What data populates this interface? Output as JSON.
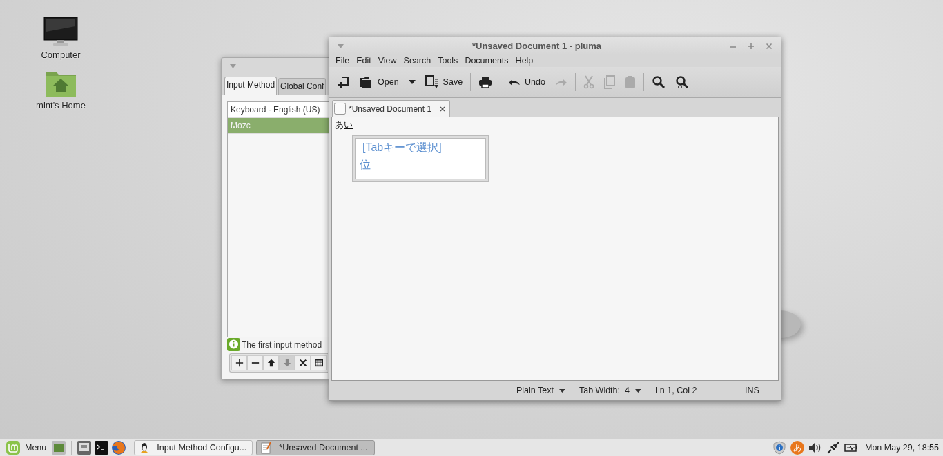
{
  "desktop": {
    "icons": [
      {
        "kind": "computer",
        "label": "Computer"
      },
      {
        "kind": "home",
        "label": "mint's Home"
      }
    ]
  },
  "config_window": {
    "tabs": [
      {
        "label": "Input Method",
        "selected": true
      },
      {
        "label": "Global Conf",
        "selected": false
      }
    ],
    "list": [
      {
        "label": "Keyboard - English (US)",
        "selected": false
      },
      {
        "label": "Mozc",
        "selected": true
      }
    ],
    "hint": "The first input method",
    "toolbar": [
      {
        "kind": "add",
        "disabled": false
      },
      {
        "kind": "remove",
        "disabled": false
      },
      {
        "kind": "up",
        "disabled": false
      },
      {
        "kind": "down",
        "disabled": true
      },
      {
        "kind": "configure",
        "disabled": false
      },
      {
        "kind": "keyboard",
        "disabled": false
      }
    ]
  },
  "editor": {
    "title": "*Unsaved Document 1 - pluma",
    "menu": [
      "File",
      "Edit",
      "View",
      "Search",
      "Tools",
      "Documents",
      "Help"
    ],
    "toolbar": [
      {
        "kind": "new",
        "disabled": false
      },
      {
        "kind": "open",
        "label": "Open",
        "disabled": false
      },
      {
        "kind": "dropdown",
        "disabled": false
      },
      {
        "kind": "save",
        "label": "Save",
        "disabled": false
      },
      {
        "kind": "sep"
      },
      {
        "kind": "print",
        "disabled": false
      },
      {
        "kind": "sep"
      },
      {
        "kind": "undo",
        "label": "Undo",
        "disabled": false
      },
      {
        "kind": "redo",
        "disabled": true
      },
      {
        "kind": "sep"
      },
      {
        "kind": "cut",
        "disabled": true
      },
      {
        "kind": "copy",
        "disabled": true
      },
      {
        "kind": "paste",
        "disabled": true
      },
      {
        "kind": "sep"
      },
      {
        "kind": "find",
        "disabled": false
      },
      {
        "kind": "replace",
        "disabled": false
      }
    ],
    "tab": {
      "label": "*Unsaved Document 1"
    },
    "text": {
      "committed": "あ",
      "preedit": "い"
    },
    "candidates": {
      "hint": "[Tabキーで選択]",
      "items": [
        "位"
      ]
    },
    "status_bar": {
      "language": "Plain Text",
      "tab_width": "Tab Width:  4",
      "position": "Ln 1, Col 2",
      "mode": "INS"
    }
  },
  "taskbar": {
    "menu_label": "Menu",
    "launchers": [
      {
        "kind": "desktop"
      },
      {
        "kind": "files"
      },
      {
        "kind": "terminal"
      },
      {
        "kind": "browser"
      }
    ],
    "windows": [
      {
        "kind": "config",
        "label": "Input Method Configu...",
        "selected": false
      },
      {
        "kind": "editor",
        "label": "*Unsaved Document ...",
        "selected": true
      }
    ],
    "ime": "あ",
    "clock": "Mon May 29, 18:55"
  }
}
